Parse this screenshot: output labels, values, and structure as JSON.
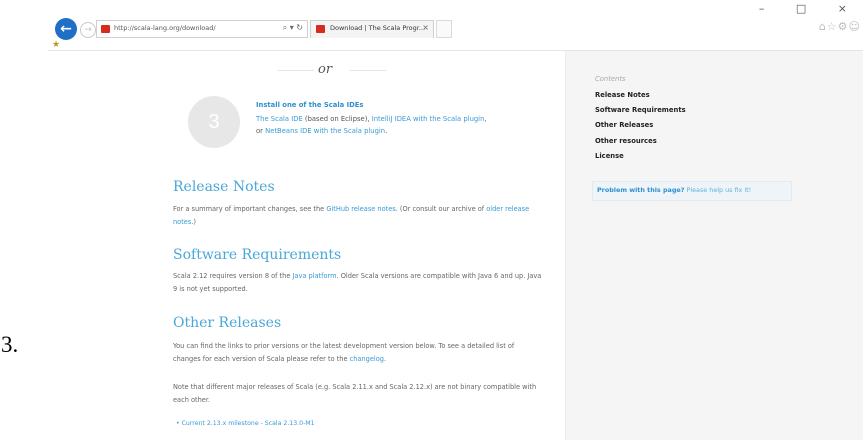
{
  "step_marker": "3.",
  "browser": {
    "url": "http://scala-lang.org/download/",
    "address_tools": "⌕ ▾ ↻",
    "tab_title": "Download | The Scala Progr...",
    "tab_close": "×",
    "window_controls": "– □ ×",
    "toolbar_icons": "⌂☆⚙☺"
  },
  "page": {
    "or_separator": "or",
    "ide_step": {
      "number": "3",
      "title": "Install one of the Scala IDEs",
      "line1_link1": "The Scala IDE",
      "line1_text": " (based on Eclipse), ",
      "line1_link2": "IntelliJ IDEA with the Scala plugin",
      "line1_end": ",",
      "line2_text": "or ",
      "line2_link": "NetBeans IDE with the Scala plugin",
      "line2_end": "."
    },
    "release_notes": {
      "heading": "Release Notes",
      "text1": "For a summary of important changes, see the ",
      "link1": "GitHub release notes",
      "text2": ". (Or consult our archive of ",
      "link2": "older release notes",
      "text3": ".)"
    },
    "software_requirements": {
      "heading": "Software Requirements",
      "text1": "Scala 2.12 requires version 8 of the ",
      "link1": "Java platform",
      "text2": ". Older Scala versions are compatible with Java 6 and up. Java 9 is not yet supported."
    },
    "other_releases": {
      "heading": "Other Releases",
      "para1_text": "You can find the links to prior versions or the latest development version below. To see a detailed list of changes for each version of Scala please refer to the ",
      "para1_link": "changelog",
      "para1_end": ".",
      "para2": "Note that different major releases of Scala (e.g. Scala 2.11.x and Scala 2.12.x) are not binary compatible with each other.",
      "bullet1": "•  Current 2.13.x milestone - Scala 2.13.0-M1"
    }
  },
  "sidebar": {
    "heading": "Contents",
    "items": [
      {
        "label": "Release Notes"
      },
      {
        "label": "Software Requirements"
      },
      {
        "label": "Other Releases"
      },
      {
        "label": "Other resources"
      },
      {
        "label": "License"
      }
    ],
    "problem_bold": "Problem with this page?",
    "problem_link": " Please help us fix it!"
  }
}
